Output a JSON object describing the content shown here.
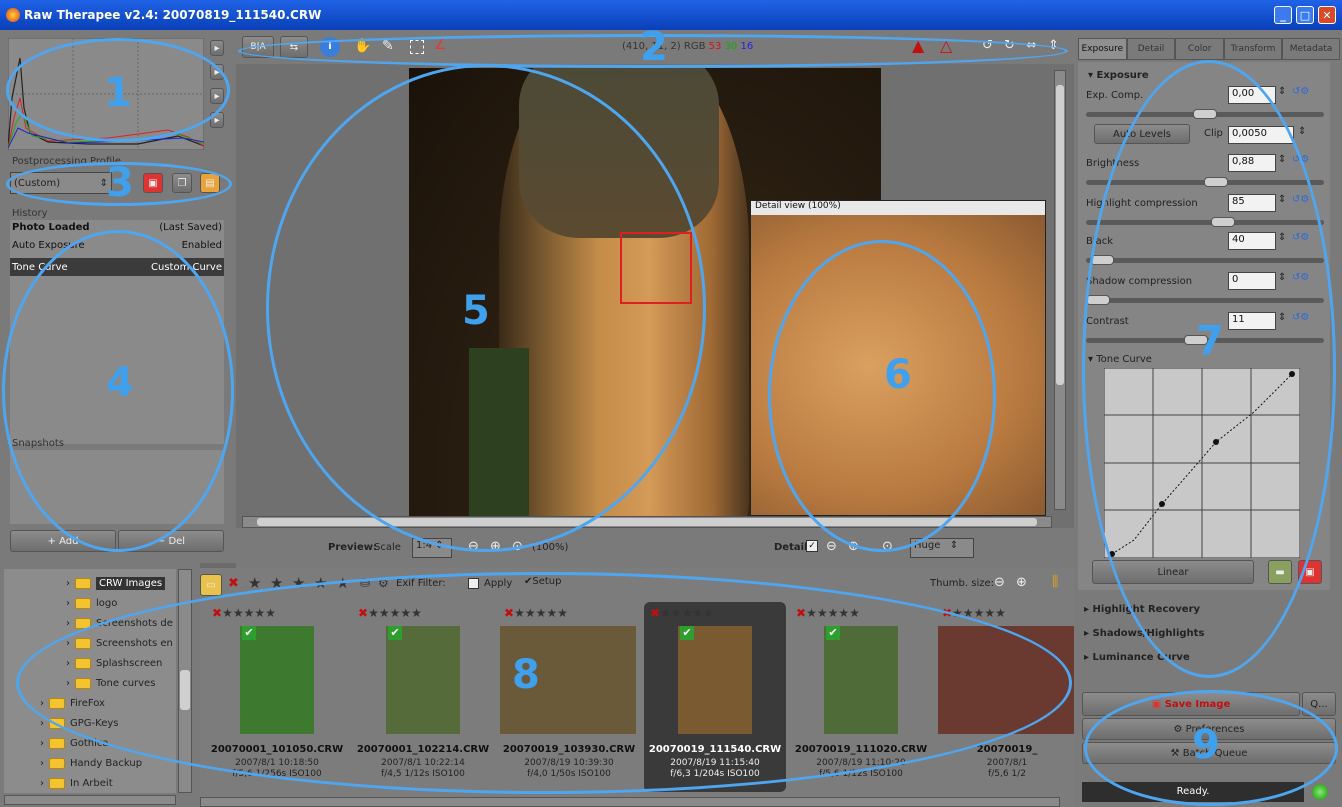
{
  "window": {
    "title": "Raw Therapee v2.4: 20070819_111540.CRW"
  },
  "toolbar": {
    "coords": "(410, 11, 2) RGB",
    "rgb_r": "53",
    "rgb_g": "30",
    "rgb_b": "16",
    "before_after": "B|A"
  },
  "profile": {
    "label": "Postprocessing Profile",
    "value": "(Custom)"
  },
  "history": {
    "label": "History",
    "rows": [
      {
        "name": "Photo Loaded",
        "value": "(Last Saved)"
      },
      {
        "name": "Auto Exposure",
        "value": "Enabled"
      },
      {
        "name": "Tone Curve",
        "value": "Custom Curve"
      }
    ]
  },
  "snapshots": {
    "label": "Snapshots",
    "add": "Add",
    "del": "Del"
  },
  "preview": {
    "label": "Preview:",
    "scale_label": "Scale",
    "scale_value": "1:4",
    "zoom_label": "(100%)",
    "detail_label": "Detail",
    "detail_size": "Huge",
    "detail_title": "Detail view (100%)"
  },
  "tabs": [
    "Exposure",
    "Detail",
    "Color",
    "Transform",
    "Metadata"
  ],
  "exposure": {
    "header": "Exposure",
    "exp_comp": {
      "label": "Exp. Comp.",
      "value": "0,00",
      "pos": 0.5
    },
    "auto_levels": "Auto Levels",
    "clip_label": "Clip",
    "clip_value": "0,0050",
    "brightness": {
      "label": "Brightness",
      "value": "0,88",
      "pos": 0.55
    },
    "highlight": {
      "label": "Highlight compression",
      "value": "85",
      "pos": 0.57
    },
    "black": {
      "label": "Black",
      "value": "40",
      "pos": 0.03
    },
    "shadow": {
      "label": "Shadow compression",
      "value": "0",
      "pos": 0.0
    },
    "contrast": {
      "label": "Contrast",
      "value": "11",
      "pos": 0.45
    },
    "tone_curve": "Tone Curve",
    "linear": "Linear"
  },
  "sections": [
    "Highlight Recovery",
    "Shadows/Highlights",
    "Luminance Curve"
  ],
  "actions": {
    "save": "Save Image",
    "more": "Q...",
    "preferences": "Preferences",
    "batch": "Batch Queue",
    "status": "Ready."
  },
  "tree": [
    {
      "name": "CRW Images",
      "level": 2,
      "selected": true
    },
    {
      "name": "logo",
      "level": 2
    },
    {
      "name": "Screenshots de",
      "level": 2
    },
    {
      "name": "Screenshots en",
      "level": 2
    },
    {
      "name": "Splashscreen",
      "level": 2
    },
    {
      "name": "Tone curves",
      "level": 2
    },
    {
      "name": "FireFox",
      "level": 1
    },
    {
      "name": "GPG-Keys",
      "level": 1
    },
    {
      "name": "Gothica",
      "level": 1
    },
    {
      "name": "Handy Backup",
      "level": 1
    },
    {
      "name": "In Arbeit",
      "level": 1
    }
  ],
  "filebrowser": {
    "exif_filter": "Exif Filter:",
    "apply": "Apply",
    "setup": "Setup",
    "thumb_size": "Thumb. size:"
  },
  "thumbnails": [
    {
      "file": "20070001_101050.CRW",
      "date": "2007/8/1 10:18:50",
      "exif": "f/5,6 1/256s ISO100",
      "color": "#3d7a2f",
      "checked": true,
      "selected": false
    },
    {
      "file": "20070001_102214.CRW",
      "date": "2007/8/1 10:22:14",
      "exif": "f/4,5 1/12s ISO100",
      "color": "#566b3a",
      "checked": true,
      "selected": false
    },
    {
      "file": "20070019_103930.CRW",
      "date": "2007/8/19 10:39:30",
      "exif": "f/4,0 1/50s ISO100",
      "color": "#6a5a3a",
      "checked": false,
      "selected": false
    },
    {
      "file": "20070019_111540.CRW",
      "date": "2007/8/19 11:15:40",
      "exif": "f/6,3 1/204s ISO100",
      "color": "#7a5a30",
      "checked": true,
      "selected": true
    },
    {
      "file": "20070019_111020.CRW",
      "date": "2007/8/19 11:10:20",
      "exif": "f/5,6 1/12s ISO100",
      "color": "#4f6b38",
      "checked": true,
      "selected": false
    },
    {
      "file": "20070019_",
      "date": "2007/8/1",
      "exif": "f/5,6 1/2",
      "color": "#6a3a30",
      "checked": false,
      "selected": false
    }
  ],
  "annotations": [
    "1",
    "2",
    "3",
    "4",
    "5",
    "6",
    "7",
    "8",
    "9"
  ]
}
